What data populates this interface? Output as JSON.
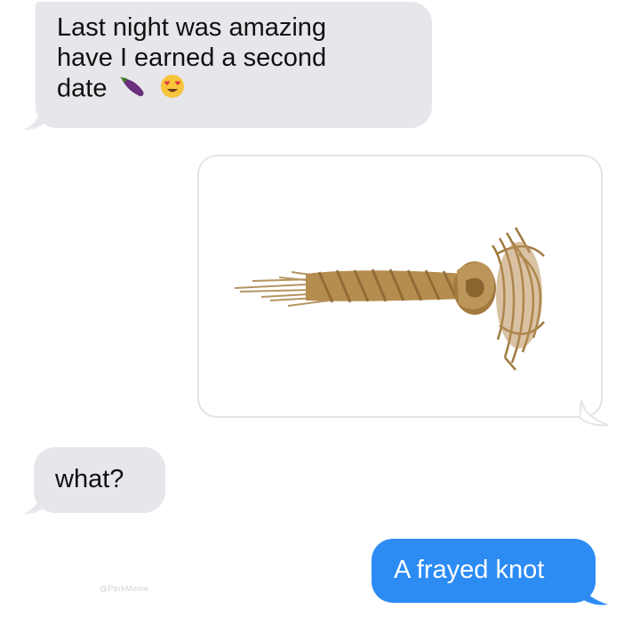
{
  "conversation": {
    "messages": [
      {
        "direction": "received",
        "lines": [
          "Last night was amazing",
          "have I earned a second",
          "date"
        ],
        "emojis": [
          "eggplant",
          "smiling-face-with-heart-eyes"
        ]
      },
      {
        "direction": "sent",
        "type": "image",
        "image_subject": "frayed-knot-rope"
      },
      {
        "direction": "received",
        "text": "what?"
      },
      {
        "direction": "sent",
        "text": "A frayed knot"
      }
    ]
  },
  "colors": {
    "received_bubble": "#e6e6eb",
    "sent_bubble": "#2c8cf4",
    "image_border": "#e4e4e8",
    "rope": "#b08a4a"
  },
  "watermark": "@PerkMeme"
}
